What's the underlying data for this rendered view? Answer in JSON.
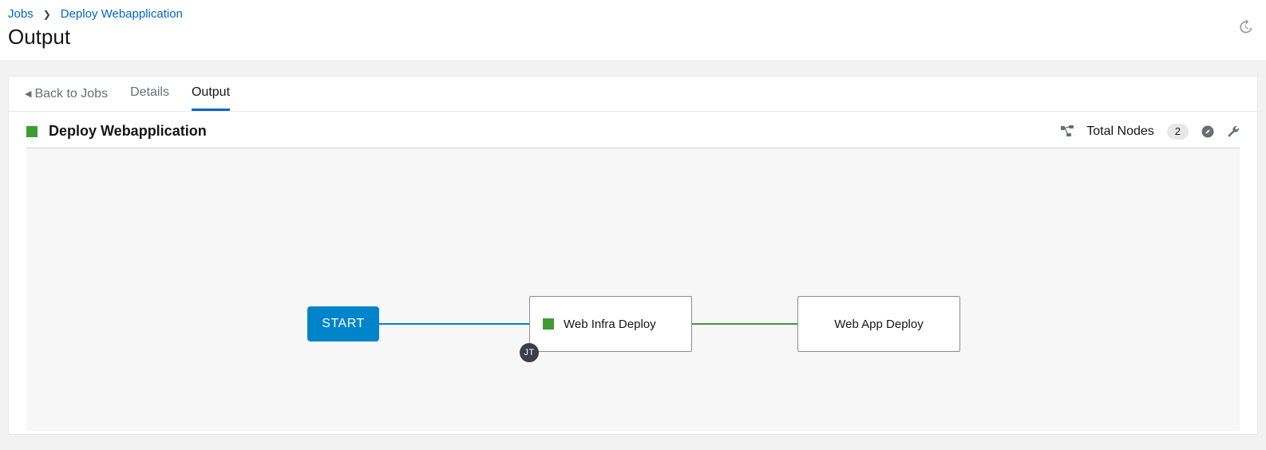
{
  "colors": {
    "status_success": "#3f9c35",
    "accent": "#0066cc",
    "start_node": "#0084c9"
  },
  "breadcrumb": {
    "root": "Jobs",
    "current": "Deploy Webapplication"
  },
  "page": {
    "title": "Output"
  },
  "tabs": {
    "back": "Back to Jobs",
    "details": "Details",
    "output": "Output"
  },
  "job": {
    "name": "Deploy Webapplication",
    "total_nodes_label": "Total Nodes",
    "total_nodes_count": "2"
  },
  "workflow": {
    "start_label": "START",
    "nodes": [
      {
        "label": "Web Infra Deploy",
        "type_badge": "JT"
      },
      {
        "label": "Web App Deploy"
      }
    ]
  }
}
